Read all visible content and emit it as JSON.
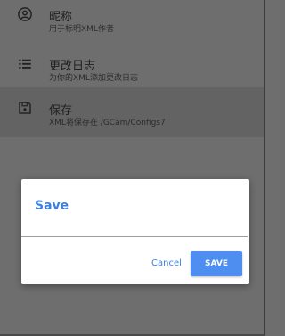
{
  "settings": {
    "items": [
      {
        "icon": "person-circle-icon",
        "title": "昵称",
        "subtitle": "用于标明XML作者"
      },
      {
        "icon": "list-icon",
        "title": "更改日志",
        "subtitle": "为你的XML添加更改日志"
      },
      {
        "icon": "save-icon",
        "title": "保存",
        "subtitle": "XML将保存在 /GCam/Configs7"
      }
    ]
  },
  "dialog": {
    "title": "Save",
    "input_value": "",
    "cancel_label": "Cancel",
    "save_label": "SAVE"
  },
  "colors": {
    "accent": "#3d7fe0",
    "button_fill": "#4d8ef0",
    "scrim": "#6e6e6e"
  }
}
